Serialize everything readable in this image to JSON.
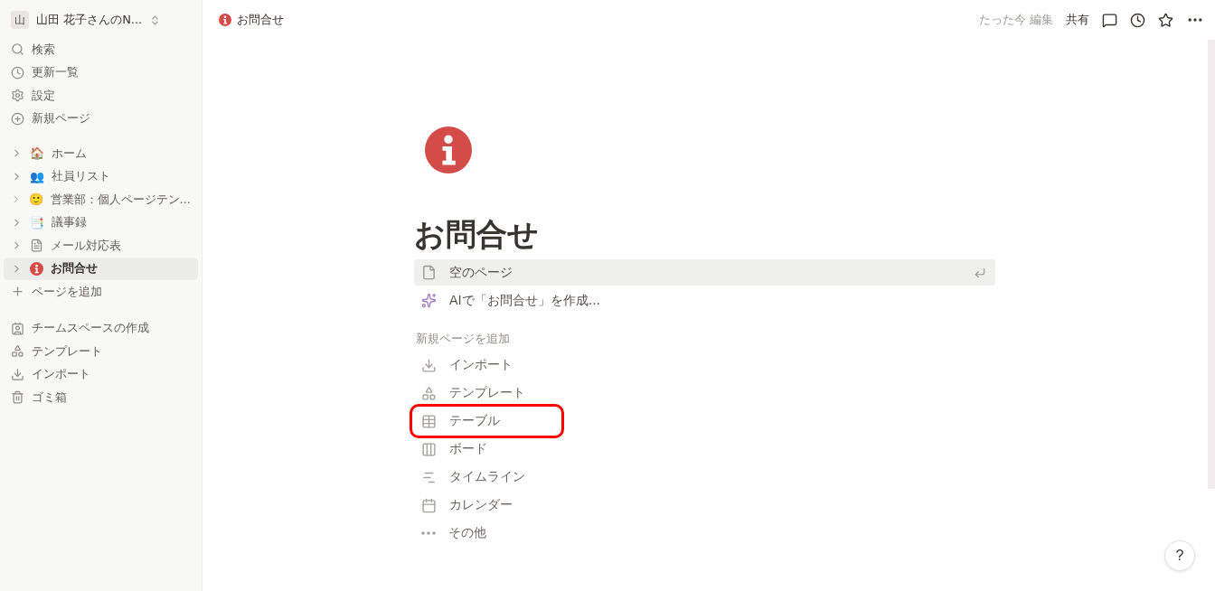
{
  "sidebar": {
    "workspace": {
      "initial": "山",
      "name": "山田 花子さんのN..."
    },
    "nav": [
      {
        "label": "検索"
      },
      {
        "label": "更新一覧"
      },
      {
        "label": "設定"
      },
      {
        "label": "新規ページ"
      }
    ],
    "pages": [
      {
        "emoji": "🏠",
        "label": "ホーム",
        "selected": false
      },
      {
        "emoji": "👥",
        "label": "社員リスト",
        "selected": false
      },
      {
        "emoji": "🙂",
        "label": "営業部：個人ページテン...",
        "selected": false
      },
      {
        "emoji": "📑",
        "label": "議事録",
        "selected": false
      },
      {
        "label": "メール対応表",
        "selected": false
      },
      {
        "label": "お問合せ",
        "selected": true
      }
    ],
    "add_page": "ページを追加",
    "bottom": [
      {
        "label": "チームスペースの作成"
      },
      {
        "label": "テンプレート"
      },
      {
        "label": "インポート"
      },
      {
        "label": "ゴミ箱"
      }
    ]
  },
  "topbar": {
    "breadcrumb": "お問合せ",
    "edited": "たった今 編集",
    "share": "共有"
  },
  "page": {
    "title": "お問合せ",
    "options": [
      {
        "label": "空のページ",
        "selected": true
      },
      {
        "label": "AIで「お問合せ」を作成...",
        "selected": false
      }
    ],
    "section_label": "新規ページを追加",
    "add_items": [
      {
        "label": "インポート",
        "highlighted": false
      },
      {
        "label": "テンプレート",
        "highlighted": false
      },
      {
        "label": "テーブル",
        "highlighted": true
      },
      {
        "label": "ボード",
        "highlighted": false
      },
      {
        "label": "タイムライン",
        "highlighted": false
      },
      {
        "label": "カレンダー",
        "highlighted": false
      },
      {
        "label": "その他",
        "highlighted": false
      }
    ]
  },
  "help": "?"
}
